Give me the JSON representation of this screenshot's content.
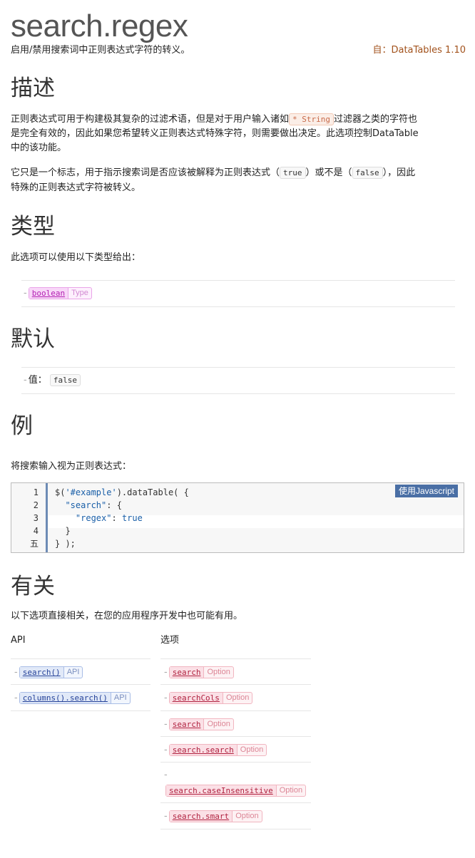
{
  "header": {
    "title": "search.regex",
    "subtitle": "启用/禁用搜索词中正则表达式字符的转义。",
    "since": "自：DataTables 1.10"
  },
  "description": {
    "heading": "描述",
    "p1_a": "正则表达式可用于构建极其复杂的过滤术语，但是对于用户输入诸如",
    "p1_code_star": "*",
    "p1_code_type": "String",
    "p1_b": "过滤器之类的字符也",
    "p1_c": "是完全有效的，因此如果您希望转义正则表达式特殊字符，则需要做出决定。此选项控制DataTable",
    "p1_d": "中的该功能。",
    "p2_a": "它只是一个标志，用于指示搜索词是否应该被解释为正则表达式（",
    "p2_true": "true",
    "p2_b": "）或不是（",
    "p2_false": "false",
    "p2_c": "），因此",
    "p2_d": "特殊的正则表达式字符被转义。"
  },
  "type": {
    "heading": "类型",
    "intro": "此选项可以使用以下类型给出：",
    "item_name": "boolean",
    "item_kind": "Type"
  },
  "default": {
    "heading": "默认",
    "label": "值：",
    "value": "false"
  },
  "example": {
    "heading": "例",
    "intro": "将搜索输入视为正则表达式：",
    "badge": "使用Javascript",
    "line_numbers": [
      "1",
      "2",
      "3",
      "4",
      "五"
    ]
  },
  "related": {
    "heading": "有关",
    "intro": "以下选项直接相关，在您的应用程序开发中也可能有用。",
    "api_col": "API",
    "opt_col": "选项",
    "api_items": [
      {
        "name": "search()",
        "kind": "API"
      },
      {
        "name": "columns().search()",
        "kind": "API"
      }
    ],
    "option_items": [
      {
        "name": "search",
        "kind": "Option"
      },
      {
        "name": "searchCols",
        "kind": "Option"
      },
      {
        "name": "search",
        "kind": "Option"
      },
      {
        "name": "search.search",
        "kind": "Option"
      },
      {
        "name": "search.caseInsensitive",
        "kind": "Option"
      },
      {
        "name": "search.smart",
        "kind": "Option"
      }
    ]
  }
}
